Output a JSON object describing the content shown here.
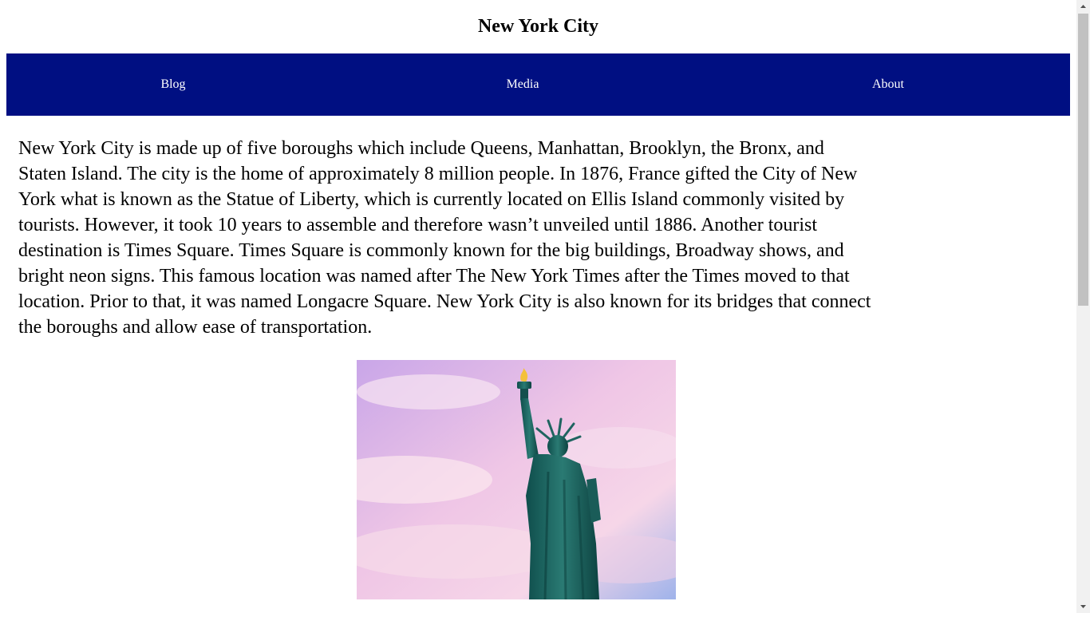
{
  "header": {
    "title": "New York City"
  },
  "nav": {
    "items": [
      {
        "label": "Blog"
      },
      {
        "label": "Media"
      },
      {
        "label": "About"
      }
    ]
  },
  "main": {
    "intro": "New York City is made up of five boroughs which include Queens, Manhattan, Brooklyn, the Bronx, and Staten Island. The city is the home of approximately 8 million people. In 1876, France gifted the City of New York what is known as the Statue of Liberty, which is currently located on Ellis Island commonly visited by tourists. However, it took 10 years to assemble and therefore wasn’t unveiled until 1886. Another tourist destination is Times Square. Times Square is commonly known for the big buildings, Broadway shows, and bright neon signs. This famous location was named after The New York Times after the Times moved to that location. Prior to that, it was named Longacre Square. New York City is also known for its bridges that connect the boroughs and allow ease of transportation."
  },
  "colors": {
    "nav_background": "#000f82",
    "nav_text": "#ffffff",
    "statue": "#1f5f5c"
  }
}
